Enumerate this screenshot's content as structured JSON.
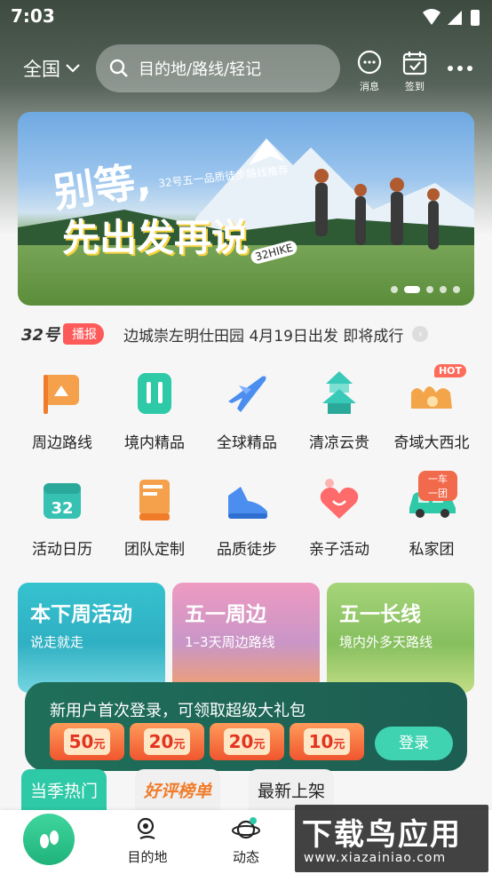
{
  "status_bar": {
    "time": "7:03"
  },
  "header": {
    "region": "全国",
    "search_placeholder": "目的地/路线/轻记",
    "messages_label": "消息",
    "checkin_label": "签到"
  },
  "banner": {
    "headline_line1": "别等,",
    "headline_line2": "先出发再说",
    "subtitle": "32号五一品质徒步路线推荐",
    "logo": "32HIKE",
    "active_dot": 1,
    "dot_count": 5
  },
  "broadcast": {
    "brand": "32号",
    "tag": "播报",
    "text": "边城崇左明仕田园 4月19日出发 即将成行"
  },
  "categories": [
    {
      "label": "周边路线",
      "icon": "flag-icon",
      "color": "#f5a04a"
    },
    {
      "label": "境内精品",
      "icon": "suitcase-icon",
      "color": "#2ec9a7"
    },
    {
      "label": "全球精品",
      "icon": "airplane-icon",
      "color": "#4b8ef0"
    },
    {
      "label": "清凉云贵",
      "icon": "pagoda-icon",
      "color": "#39c9b9"
    },
    {
      "label": "奇域大西北",
      "icon": "camel-icon",
      "color": "#f3a54a",
      "badge": "HOT"
    },
    {
      "label": "活动日历",
      "icon": "calendar-icon",
      "color": "#36c1b3"
    },
    {
      "label": "团队定制",
      "icon": "book-icon",
      "color": "#f5a04a"
    },
    {
      "label": "品质徒步",
      "icon": "shoe-icon",
      "color": "#4b8ef0"
    },
    {
      "label": "亲子活动",
      "icon": "heart-icon",
      "color": "#ff6a6a"
    },
    {
      "label": "私家团",
      "icon": "car-icon",
      "color": "#2ec9a7",
      "badge": "一车一团"
    }
  ],
  "feature_cards": [
    {
      "title": "本下周活动",
      "subtitle": "说走就走",
      "bg": "#2fb8c8"
    },
    {
      "title": "五一周边",
      "subtitle": "1–3天周边路线",
      "bg": "#e892b8"
    },
    {
      "title": "五一长线",
      "subtitle": "境内外多天路线",
      "bg": "#8dc66a"
    }
  ],
  "promo": {
    "text": "新用户首次登录，可领取超级大礼包",
    "coupons": [
      {
        "amount": "50",
        "unit": "元"
      },
      {
        "amount": "20",
        "unit": "元"
      },
      {
        "amount": "20",
        "unit": "元"
      },
      {
        "amount": "10",
        "unit": "元"
      }
    ],
    "login_label": "登录"
  },
  "content_tabs": [
    "当季热门",
    "好评榜单",
    "最新上架"
  ],
  "bottom_nav": [
    {
      "label": "目的地",
      "icon": "location-icon"
    },
    {
      "label": "动态",
      "icon": "planet-icon"
    }
  ],
  "watermark": {
    "text": "下载鸟应用",
    "url": "www.xiazainiao.com"
  }
}
